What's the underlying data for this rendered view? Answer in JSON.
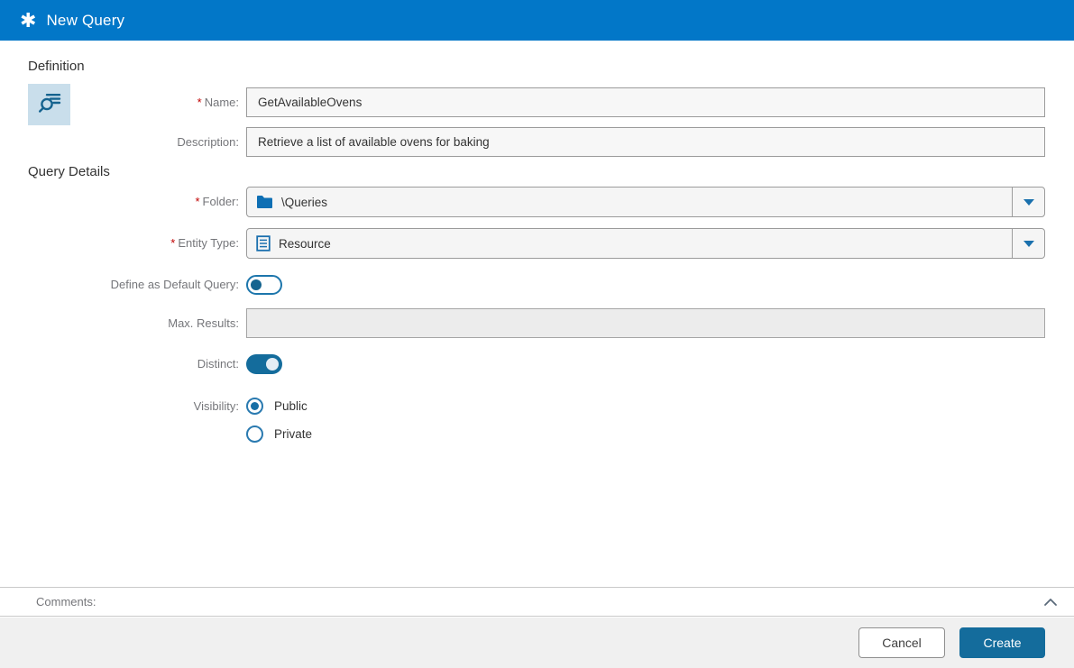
{
  "header": {
    "title": "New Query",
    "icon": "asterisk-icon",
    "icon_glyph": "✱",
    "bg_color": "#0277c8"
  },
  "sections": {
    "definition": "Definition",
    "query_details": "Query Details"
  },
  "required_marker": "*",
  "fields": {
    "name": {
      "label": "Name:",
      "required": true,
      "value": "GetAvailableOvens"
    },
    "description": {
      "label": "Description:",
      "required": false,
      "value": "Retrieve a list of available ovens for baking"
    },
    "folder": {
      "label": "Folder:",
      "required": true,
      "value": "\\Queries",
      "icon": "folder-icon"
    },
    "entity_type": {
      "label": "Entity Type:",
      "required": true,
      "value": "Resource",
      "icon": "document-icon"
    },
    "default_query": {
      "label": "Define as Default Query:",
      "state": "off"
    },
    "max_results": {
      "label": "Max. Results:",
      "value": "",
      "disabled": true
    },
    "distinct": {
      "label": "Distinct:",
      "state": "on"
    },
    "visibility": {
      "label": "Visibility:",
      "selected": "Public",
      "options": [
        {
          "label": "Public",
          "selected": true
        },
        {
          "label": "Private",
          "selected": false
        }
      ]
    }
  },
  "comments": {
    "label": "Comments:",
    "collapse_icon": "chevron-up-icon"
  },
  "footer": {
    "cancel_label": "Cancel",
    "create_label": "Create"
  },
  "colors": {
    "header_blue": "#0277c8",
    "accent_blue": "#146c9c",
    "tile_bg": "#c9deeb",
    "icon_blue": "#15638f",
    "label_gray": "#75767a",
    "text_dark": "#333333",
    "border_gray": "#9b9b9b",
    "required_red": "#c00000",
    "footer_bg": "#f0f0f0"
  }
}
